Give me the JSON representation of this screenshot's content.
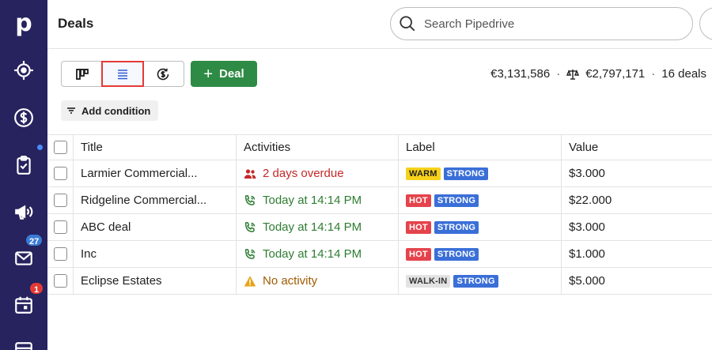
{
  "app": {
    "logo_letter": "p",
    "brand_color": "#26235e"
  },
  "sidebar": {
    "items": [
      {
        "name": "leads",
        "icon": "target-icon"
      },
      {
        "name": "deals",
        "icon": "dollar-icon"
      },
      {
        "name": "activities",
        "icon": "clipboard-check-icon",
        "has_dot": true
      },
      {
        "name": "campaigns",
        "icon": "megaphone-icon"
      },
      {
        "name": "mail",
        "icon": "mail-icon",
        "badge": "27"
      },
      {
        "name": "calendar",
        "icon": "calendar-icon",
        "badge": "1"
      }
    ]
  },
  "header": {
    "title": "Deals",
    "search_placeholder": "Search Pipedrive",
    "extra_button": "+"
  },
  "toolbar": {
    "views": [
      "pipeline",
      "list",
      "forecast"
    ],
    "active_view": "list",
    "add_deal_label": "Deal",
    "summary_total": "€3,131,586",
    "summary_weighted": "€2,797,171",
    "summary_count": "16 deals",
    "add_condition_label": "Add condition"
  },
  "table": {
    "columns": [
      "Title",
      "Activities",
      "Label",
      "Value"
    ],
    "rows": [
      {
        "title": "Larmier Commercial...",
        "activity": "2 days overdue",
        "activity_type": "overdue",
        "labels": [
          {
            "text": "WARM",
            "kind": "warm"
          },
          {
            "text": "STRONG",
            "kind": "strong"
          }
        ],
        "value": "$3.000"
      },
      {
        "title": "Ridgeline Commercial...",
        "activity": "Today at 14:14 PM",
        "activity_type": "today",
        "labels": [
          {
            "text": "HOT",
            "kind": "hot"
          },
          {
            "text": "STRONG",
            "kind": "strong"
          }
        ],
        "value": "$22.000"
      },
      {
        "title": "ABC deal",
        "activity": "Today at 14:14 PM",
        "activity_type": "today",
        "labels": [
          {
            "text": "HOT",
            "kind": "hot"
          },
          {
            "text": "STRONG",
            "kind": "strong"
          }
        ],
        "value": "$3.000"
      },
      {
        "title": "Inc",
        "activity": "Today at 14:14 PM",
        "activity_type": "today",
        "labels": [
          {
            "text": "HOT",
            "kind": "hot"
          },
          {
            "text": "STRONG",
            "kind": "strong"
          }
        ],
        "value": "$1.000"
      },
      {
        "title": "Eclipse Estates",
        "activity": "No activity",
        "activity_type": "none",
        "labels": [
          {
            "text": "WALK-IN",
            "kind": "walkin"
          },
          {
            "text": "STRONG",
            "kind": "strong"
          }
        ],
        "value": "$5.000"
      }
    ]
  }
}
